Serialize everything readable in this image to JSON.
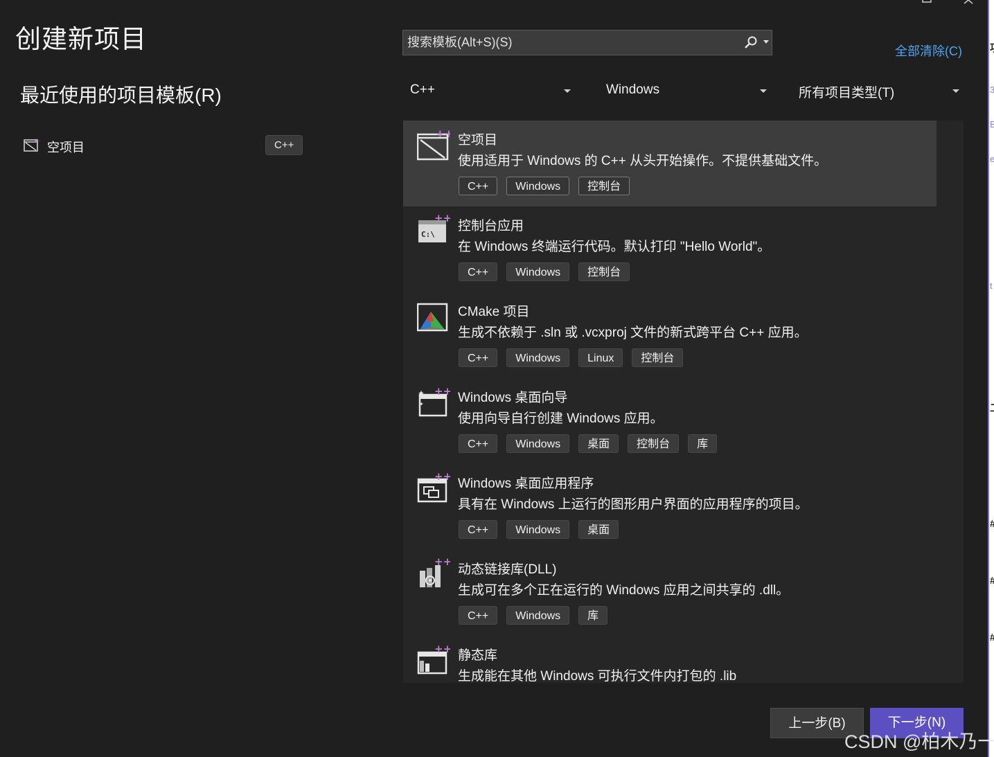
{
  "window": {
    "caption_buttons": [
      "minimize-icon",
      "maximize-icon",
      "close-icon"
    ]
  },
  "page_title": "创建新项目",
  "recent": {
    "heading": "最近使用的项目模板(R)",
    "items": [
      {
        "label": "空项目",
        "tag": "C++",
        "icon": "empty-project-icon"
      }
    ]
  },
  "search": {
    "placeholder": "搜索模板(Alt+S)(S)",
    "value": "",
    "icon": "search-icon"
  },
  "clear_all": "全部清除(C)",
  "filters": {
    "language": "C++",
    "platform": "Windows",
    "project_type": "所有项目类型(T)"
  },
  "templates": [
    {
      "title": "空项目",
      "description": "使用适用于 Windows 的 C++ 从头开始操作。不提供基础文件。",
      "tags": [
        "C++",
        "Windows",
        "控制台"
      ],
      "icon": "empty-project-icon",
      "selected": true
    },
    {
      "title": "控制台应用",
      "description": "在 Windows 终端运行代码。默认打印 \"Hello World\"。",
      "tags": [
        "C++",
        "Windows",
        "控制台"
      ],
      "icon": "console-app-icon",
      "selected": false
    },
    {
      "title": "CMake 项目",
      "description": "生成不依赖于 .sln 或 .vcxproj 文件的新式跨平台 C++ 应用。",
      "tags": [
        "C++",
        "Windows",
        "Linux",
        "控制台"
      ],
      "icon": "cmake-icon",
      "selected": false
    },
    {
      "title": "Windows 桌面向导",
      "description": "使用向导自行创建 Windows 应用。",
      "tags": [
        "C++",
        "Windows",
        "桌面",
        "控制台",
        "库"
      ],
      "icon": "desktop-wizard-icon",
      "selected": false
    },
    {
      "title": "Windows 桌面应用程序",
      "description": "具有在 Windows 上运行的图形用户界面的应用程序的项目。",
      "tags": [
        "C++",
        "Windows",
        "桌面"
      ],
      "icon": "desktop-app-icon",
      "selected": false
    },
    {
      "title": "动态链接库(DLL)",
      "description": "生成可在多个正在运行的 Windows 应用之间共享的 .dll。",
      "tags": [
        "C++",
        "Windows",
        "库"
      ],
      "icon": "dll-icon",
      "selected": false
    },
    {
      "title": "静态库",
      "description": "生成能在其他 Windows 可执行文件内打包的 .lib",
      "tags": [],
      "icon": "static-library-icon",
      "selected": false
    }
  ],
  "buttons": {
    "back": "上一步(B)",
    "next": "下一步(N)"
  },
  "watermark": "CSDN @柏木乃一",
  "colors": {
    "background": "#1f1f1f",
    "list_background": "#262626",
    "selected_row": "#3d3d3d",
    "accent": "#5b4fc2",
    "link": "#4fa3f0",
    "icon_plus": "#c27bd8"
  }
}
